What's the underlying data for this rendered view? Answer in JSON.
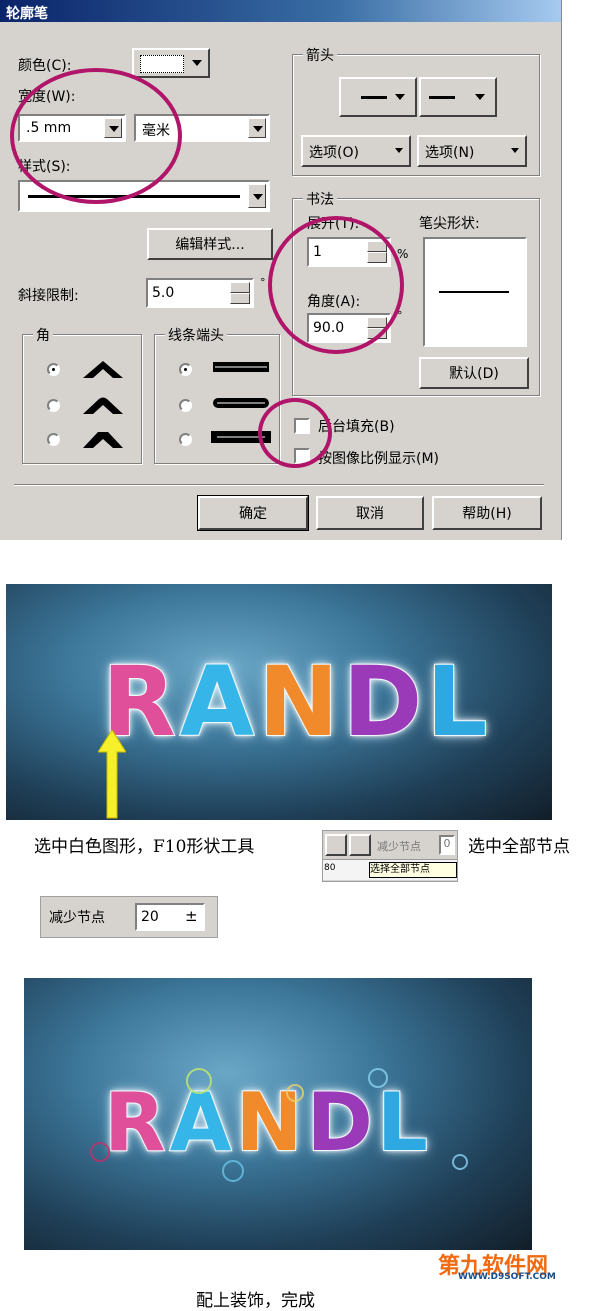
{
  "dialog": {
    "title": "轮廓笔",
    "color_label": "颜色(C):",
    "width_label": "宽度(W):",
    "width_value": ".5 mm",
    "unit_value": "毫米",
    "style_label": "样式(S):",
    "edit_style_button": "编辑样式...",
    "miter_label": "斜接限制:",
    "miter_value": "5.0",
    "miter_unit": "°",
    "corners_group": "角",
    "line_caps_group": "线条端头",
    "arrows_group": "箭头",
    "options_left": "选项(O)",
    "options_right": "选项(N)",
    "calligraphy_group": "书法",
    "stretch_label": "展开(T):",
    "stretch_value": "1",
    "stretch_unit": "%",
    "angle_label": "角度(A):",
    "angle_value": "90.0",
    "angle_unit": "°",
    "nib_shape_label": "笔尖形状:",
    "default_button": "默认(D)",
    "behind_fill_label": "后台填充(B)",
    "scale_with_image_label": "按图像比例显示(M)",
    "ok_button": "确定",
    "cancel_button": "取消",
    "help_button": "帮助(H)"
  },
  "image1": {
    "text_letters": [
      "R",
      "A",
      "N",
      "D",
      "L"
    ],
    "letter_colors": [
      "#e0509a",
      "#36b6e8",
      "#f08a2a",
      "#9a3ab8",
      "#2ea8e0"
    ]
  },
  "caption1": {
    "left": "选中白色图形，F10形状工具",
    "right": "选中全部节点",
    "toolbar_reduce_label": "减少节点",
    "toolbar_reduce_value": "0",
    "toolbar_select_all": "选择全部节点",
    "ruler_label": "80"
  },
  "reduce_box": {
    "label": "减少节点",
    "value": "20"
  },
  "image2": {
    "text_letters": [
      "R",
      "A",
      "N",
      "D",
      "L"
    ]
  },
  "watermark": {
    "line1": "第九软件网",
    "line2": "WWW.D9SOFT.COM"
  },
  "caption2": "配上装饰，完成",
  "colors": {
    "highlight_circle": "#b0156a",
    "arrow_yellow": "#f5f02a",
    "watermark_orange": "#f26a0f"
  }
}
